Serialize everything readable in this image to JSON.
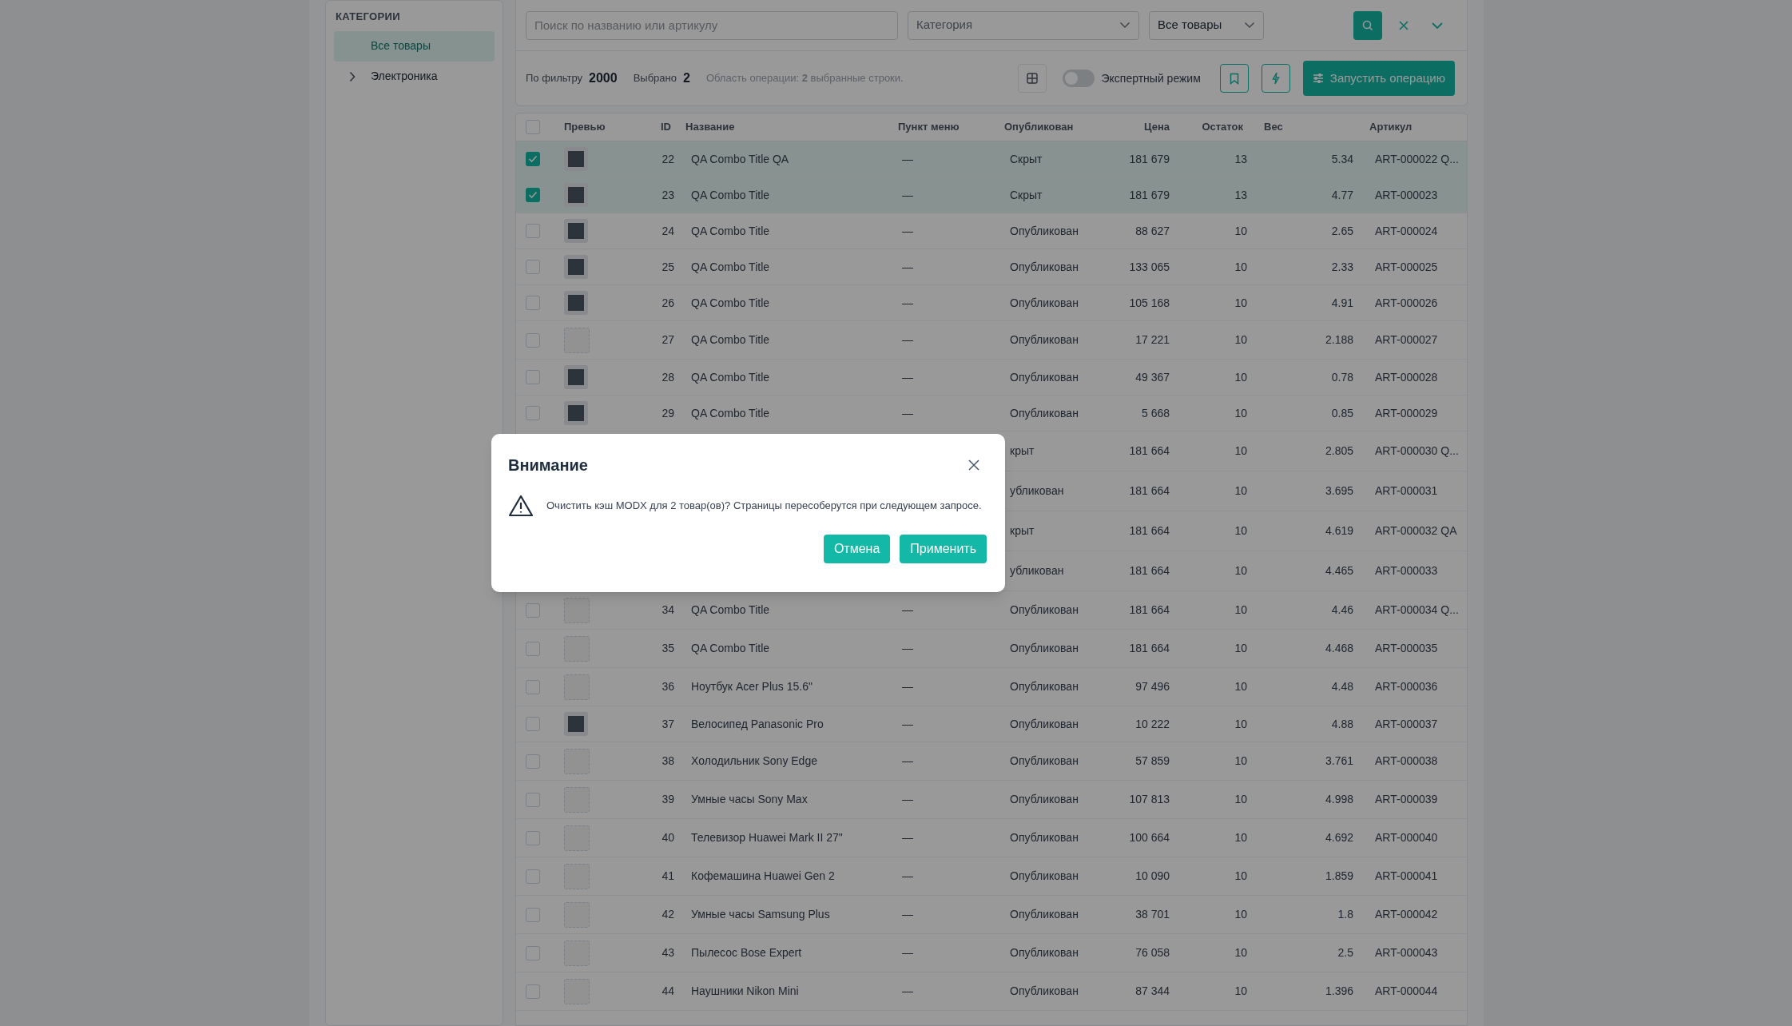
{
  "sidebar": {
    "title": "КАТЕГОРИИ",
    "items": [
      {
        "label": "Все товары",
        "selected": true,
        "has_children": false
      },
      {
        "label": "Электроника",
        "selected": false,
        "has_children": true
      }
    ]
  },
  "filters": {
    "search": {
      "placeholder": "Поиск по названию или артикулу"
    },
    "category": {
      "placeholder": "Категория"
    },
    "scope": {
      "value": "Все товары"
    }
  },
  "summary": {
    "filter_label": "По фильтру",
    "filter_count": "2000",
    "selected_label": "Выбрано",
    "selected_count": "2",
    "scope_text": "Область операции: **2** выбранные строки."
  },
  "toolbar": {
    "expert_mode": {
      "label": "Экспертный режим",
      "on": false
    },
    "run_button": "Запустить операцию"
  },
  "table": {
    "select_all": {
      "checked": false
    },
    "columns": [
      "Превью",
      "ID",
      "Название",
      "Пункт меню",
      "Опубликован",
      "Цена",
      "Остаток",
      "Вес",
      "Артикул"
    ],
    "rows": [
      {
        "kind": "full",
        "checked": true,
        "preview": {
          "kind": "photo"
        },
        "id": "22",
        "name": "QA Combo Title QA",
        "menu": "—",
        "published": "Скрыт",
        "price": "181 679",
        "stock": "13",
        "weight": "5.34",
        "article": "ART-000022 Q..."
      },
      {
        "kind": "full",
        "checked": true,
        "preview": {
          "kind": "photo"
        },
        "id": "23",
        "name": "QA Combo Title",
        "menu": "—",
        "published": "Скрыт",
        "price": "181 679",
        "stock": "13",
        "weight": "4.77",
        "article": "ART-000023"
      },
      {
        "kind": "full",
        "checked": false,
        "preview": {
          "kind": "photo"
        },
        "id": "24",
        "name": "QA Combo Title",
        "menu": "—",
        "published": "Опубликован",
        "price": "88 627",
        "stock": "10",
        "weight": "2.65",
        "article": "ART-000024"
      },
      {
        "kind": "full",
        "checked": false,
        "preview": {
          "kind": "photo"
        },
        "id": "25",
        "name": "QA Combo Title",
        "menu": "—",
        "published": "Опубликован",
        "price": "133 065",
        "stock": "10",
        "weight": "2.33",
        "article": "ART-000025"
      },
      {
        "kind": "full",
        "checked": false,
        "preview": {
          "kind": "photo"
        },
        "id": "26",
        "name": "QA Combo Title",
        "menu": "—",
        "published": "Опубликован",
        "price": "105 168",
        "stock": "10",
        "weight": "4.91",
        "article": "ART-000026"
      },
      {
        "kind": "full",
        "checked": false,
        "preview": {
          "kind": "empty"
        },
        "id": "27",
        "name": "QA Combo Title",
        "menu": "—",
        "published": "Опубликован",
        "price": "17 221",
        "stock": "10",
        "weight": "2.188",
        "article": "ART-000027"
      },
      {
        "kind": "full",
        "checked": false,
        "preview": {
          "kind": "photo"
        },
        "id": "28",
        "name": "QA Combo Title",
        "menu": "—",
        "published": "Опубликован",
        "price": "49 367",
        "stock": "10",
        "weight": "0.78",
        "article": "ART-000028"
      },
      {
        "kind": "full",
        "checked": false,
        "preview": {
          "kind": "photo"
        },
        "id": "29",
        "name": "QA Combo Title",
        "menu": "—",
        "published": "Опубликован",
        "price": "5 668",
        "stock": "10",
        "weight": "0.85",
        "article": "ART-000029"
      },
      {
        "kind": "partial",
        "published": "крыт",
        "price": "181 664",
        "stock": "10",
        "weight": "2.805",
        "article": "ART-000030 Q..."
      },
      {
        "kind": "partial",
        "published": "убликован",
        "price": "181 664",
        "stock": "10",
        "weight": "3.695",
        "article": "ART-000031"
      },
      {
        "kind": "partial",
        "published": "крыт",
        "price": "181 664",
        "stock": "10",
        "weight": "4.619",
        "article": "ART-000032 QA"
      },
      {
        "kind": "partial",
        "published": "убликован",
        "price": "181 664",
        "stock": "10",
        "weight": "4.465",
        "article": "ART-000033"
      },
      {
        "kind": "full",
        "checked": false,
        "preview": {
          "kind": "empty"
        },
        "id": "34",
        "name": "QA Combo Title",
        "menu": "—",
        "published": "Опубликован",
        "price": "181 664",
        "stock": "10",
        "weight": "4.46",
        "article": "ART-000034 Q..."
      },
      {
        "kind": "full",
        "checked": false,
        "preview": {
          "kind": "empty"
        },
        "id": "35",
        "name": "QA Combo Title",
        "menu": "—",
        "published": "Опубликован",
        "price": "181 664",
        "stock": "10",
        "weight": "4.468",
        "article": "ART-000035"
      },
      {
        "kind": "full",
        "checked": false,
        "preview": {
          "kind": "empty"
        },
        "id": "36",
        "name": "Ноутбук Acer Plus 15.6\"",
        "menu": "—",
        "published": "Опубликован",
        "price": "97 496",
        "stock": "10",
        "weight": "4.48",
        "article": "ART-000036"
      },
      {
        "kind": "full",
        "checked": false,
        "preview": {
          "kind": "photo"
        },
        "id": "37",
        "name": "Велосипед Panasonic Pro",
        "menu": "—",
        "published": "Опубликован",
        "price": "10 222",
        "stock": "10",
        "weight": "4.88",
        "article": "ART-000037"
      },
      {
        "kind": "full",
        "checked": false,
        "preview": {
          "kind": "empty"
        },
        "id": "38",
        "name": "Холодильник Sony Edge",
        "menu": "—",
        "published": "Опубликован",
        "price": "57 859",
        "stock": "10",
        "weight": "3.761",
        "article": "ART-000038"
      },
      {
        "kind": "full",
        "checked": false,
        "preview": {
          "kind": "empty"
        },
        "id": "39",
        "name": "Умные часы Sony Max",
        "menu": "—",
        "published": "Опубликован",
        "price": "107 813",
        "stock": "10",
        "weight": "4.998",
        "article": "ART-000039"
      },
      {
        "kind": "full",
        "checked": false,
        "preview": {
          "kind": "empty"
        },
        "id": "40",
        "name": "Телевизор Huawei Mark II 27\"",
        "menu": "—",
        "published": "Опубликован",
        "price": "100 664",
        "stock": "10",
        "weight": "4.692",
        "article": "ART-000040"
      },
      {
        "kind": "full",
        "checked": false,
        "preview": {
          "kind": "empty"
        },
        "id": "41",
        "name": "Кофемашина Huawei Gen 2",
        "menu": "—",
        "published": "Опубликован",
        "price": "10 090",
        "stock": "10",
        "weight": "1.859",
        "article": "ART-000041"
      },
      {
        "kind": "full",
        "checked": false,
        "preview": {
          "kind": "empty"
        },
        "id": "42",
        "name": "Умные часы Samsung Plus",
        "menu": "—",
        "published": "Опубликован",
        "price": "38 701",
        "stock": "10",
        "weight": "1.8",
        "article": "ART-000042"
      },
      {
        "kind": "full",
        "checked": false,
        "preview": {
          "kind": "empty"
        },
        "id": "43",
        "name": "Пылесос Bose Expert",
        "menu": "—",
        "published": "Опубликован",
        "price": "76 058",
        "stock": "10",
        "weight": "2.5",
        "article": "ART-000043"
      },
      {
        "kind": "full",
        "checked": false,
        "preview": {
          "kind": "empty"
        },
        "id": "44",
        "name": "Наушники Nikon Mini",
        "menu": "—",
        "published": "Опубликован",
        "price": "87 344",
        "stock": "10",
        "weight": "1.396",
        "article": "ART-000044"
      }
    ]
  },
  "dialog": {
    "title": "Внимание",
    "message": "Очистить кэш MODX для 2 товар(ов)? Страницы пересоберутся при следующем запросе.",
    "buttons": [
      "Отмена",
      "Применить"
    ]
  }
}
